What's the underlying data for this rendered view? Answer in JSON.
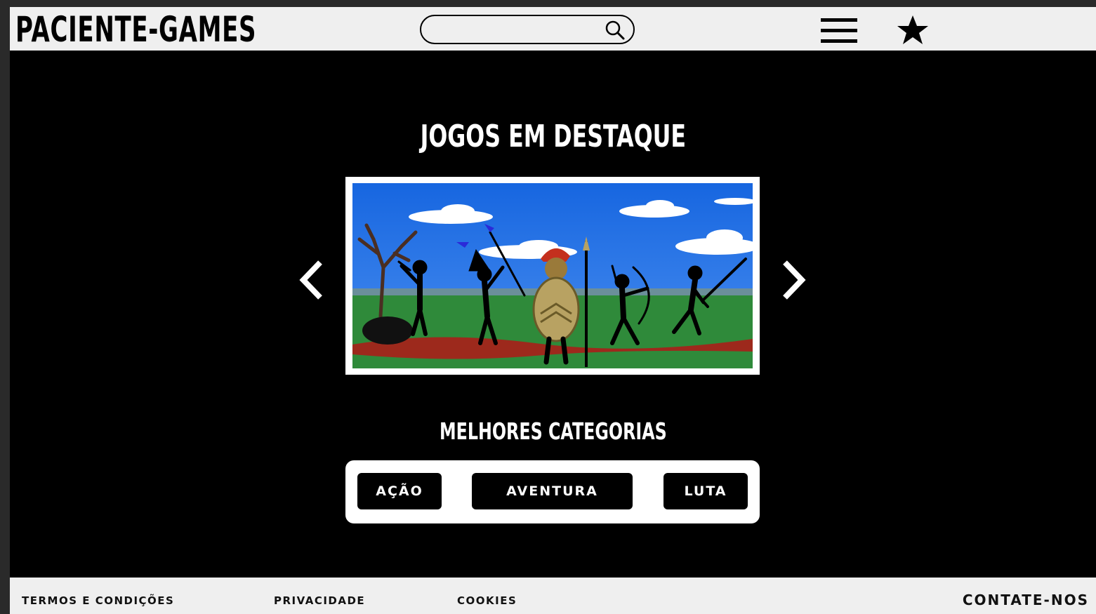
{
  "header": {
    "logo": "PACIENTE-GAMES",
    "search": {
      "value": "",
      "placeholder": ""
    },
    "icons": [
      "search-icon",
      "menu-icon",
      "star-icon"
    ]
  },
  "featured": {
    "title": "JOGOS EM DESTAQUE",
    "image": "stick-war-warriors-banner",
    "nav": [
      "chevron-left-icon",
      "chevron-right-icon"
    ]
  },
  "categories": {
    "title": "MELHORES CATEGORIAS",
    "items": [
      "AÇÃO",
      "AVENTURA",
      "LUTA"
    ]
  },
  "footer": {
    "links": [
      "TERMOS E CONDIÇÕES",
      "PRIVACIDADE",
      "COOKIES"
    ],
    "contact": "CONTATE-NOS"
  },
  "colors": {
    "background": "#000000",
    "bars": "#efefef",
    "text_light": "#ffffff",
    "sky": "#1f6fe0",
    "grass": "#2f8a3a"
  }
}
